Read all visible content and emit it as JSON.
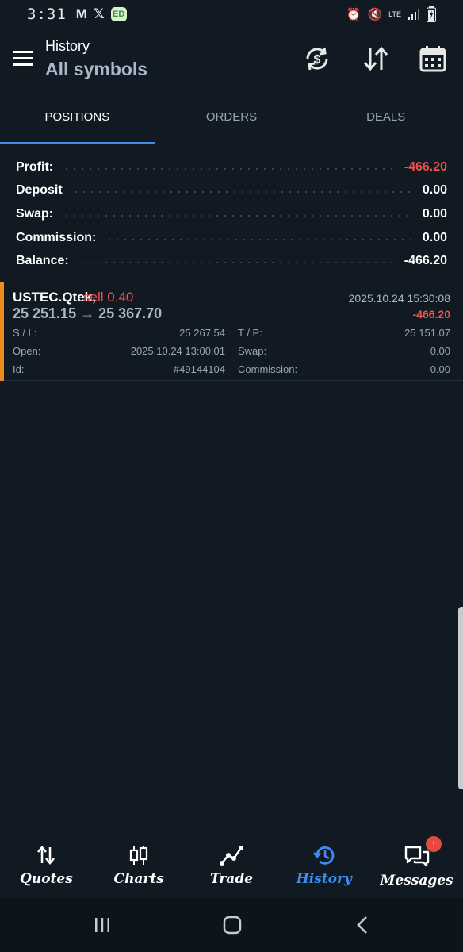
{
  "status": {
    "time": "3:31",
    "network": "LTE"
  },
  "header": {
    "title": "History",
    "subtitle": "All symbols"
  },
  "tabs": [
    {
      "label": "POSITIONS",
      "active": true
    },
    {
      "label": "ORDERS",
      "active": false
    },
    {
      "label": "DEALS",
      "active": false
    }
  ],
  "summary": [
    {
      "label": "Profit:",
      "value": "-466.20",
      "negative": true
    },
    {
      "label": "Deposit",
      "value": "0.00",
      "negative": false
    },
    {
      "label": "Swap:",
      "value": "0.00",
      "negative": false
    },
    {
      "label": "Commission:",
      "value": "0.00",
      "negative": false
    },
    {
      "label": "Balance:",
      "value": "-466.20",
      "negative": false
    }
  ],
  "position": {
    "symbol": "USTEC.Qtek,",
    "side": "sell 0.40",
    "prices": "25 251.15 → 25 367.70",
    "datetime": "2025.10.24 15:30:08",
    "profit": "-466.20",
    "sl_label": "S / L:",
    "sl_value": "25 267.54",
    "tp_label": "T / P:",
    "tp_value": "25 151.07",
    "open_label": "Open:",
    "open_value": "2025.10.24 13:00:01",
    "swap_label": "Swap:",
    "swap_value": "0.00",
    "id_label": "Id:",
    "id_value": "#49144104",
    "commission_label": "Commission:",
    "commission_value": "0.00"
  },
  "bottom_nav": [
    {
      "label": "Quotes",
      "icon": "quotes-icon",
      "active": false
    },
    {
      "label": "Charts",
      "icon": "charts-icon",
      "active": false
    },
    {
      "label": "Trade",
      "icon": "trade-icon",
      "active": false
    },
    {
      "label": "History",
      "icon": "history-icon",
      "active": true
    },
    {
      "label": "Messages",
      "icon": "messages-icon",
      "active": false,
      "badge": "!"
    }
  ],
  "colors": {
    "background": "#111a22",
    "accent": "#3e8cf0",
    "negative": "#f0504a",
    "position_marker": "#f08a1a"
  }
}
